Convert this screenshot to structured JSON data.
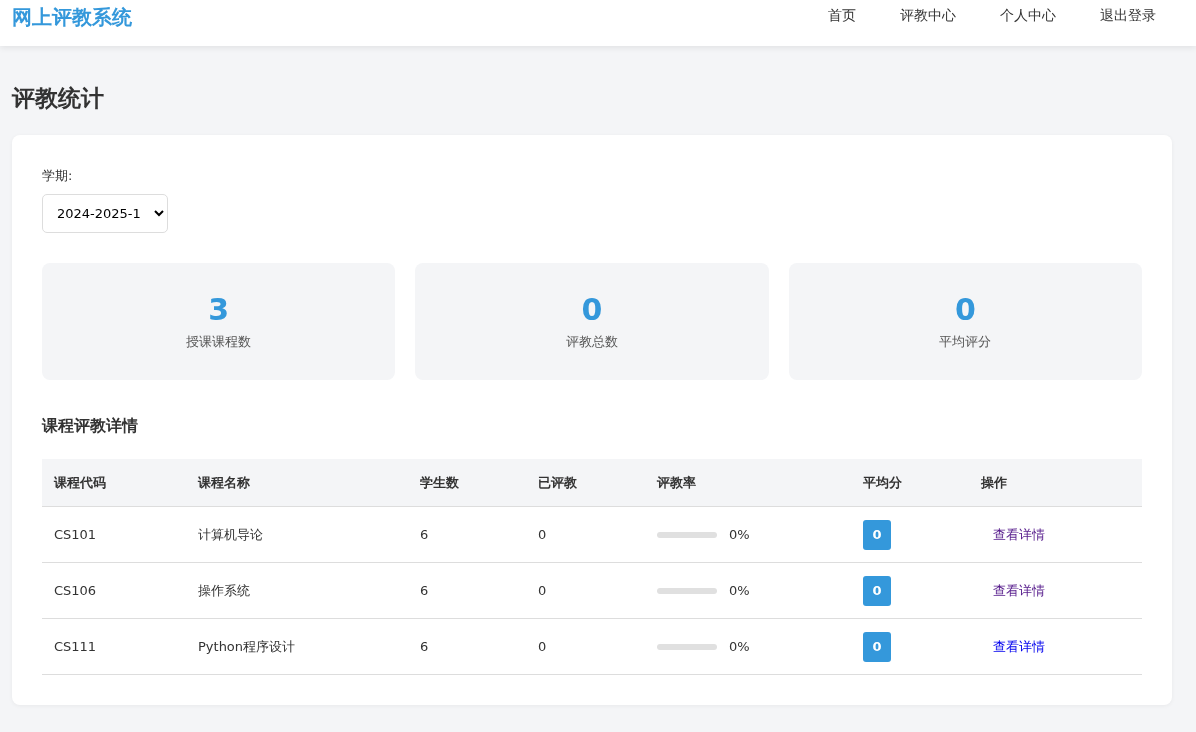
{
  "header": {
    "brand": "网上评教系统",
    "nav": [
      {
        "label": "首页"
      },
      {
        "label": "评教中心"
      },
      {
        "label": "个人中心"
      },
      {
        "label": "退出登录"
      }
    ]
  },
  "page_title": "评教统计",
  "filter": {
    "label": "学期:",
    "value": "2024-2025-1"
  },
  "stats": [
    {
      "value": "3",
      "label": "授课课程数"
    },
    {
      "value": "0",
      "label": "评教总数"
    },
    {
      "value": "0",
      "label": "平均评分"
    }
  ],
  "section_title": "课程评教详情",
  "table": {
    "columns": [
      "课程代码",
      "课程名称",
      "学生数",
      "已评教",
      "评教率",
      "平均分",
      "操作"
    ],
    "rows": [
      {
        "code": "CS101",
        "name": "计算机导论",
        "students": "6",
        "evaluated": "0",
        "level": 0,
        "rate": "0%",
        "score": "0",
        "action": "查看详情",
        "visited": true
      },
      {
        "code": "CS106",
        "name": "操作系统",
        "students": "6",
        "evaluated": "0",
        "level": 0,
        "rate": "0%",
        "score": "0",
        "action": "查看详情",
        "visited": true
      },
      {
        "code": "CS111",
        "name": "Python程序设计",
        "students": "6",
        "evaluated": "0",
        "level": 0,
        "rate": "0%",
        "score": "0",
        "action": "查看详情",
        "visited": false
      }
    ]
  }
}
